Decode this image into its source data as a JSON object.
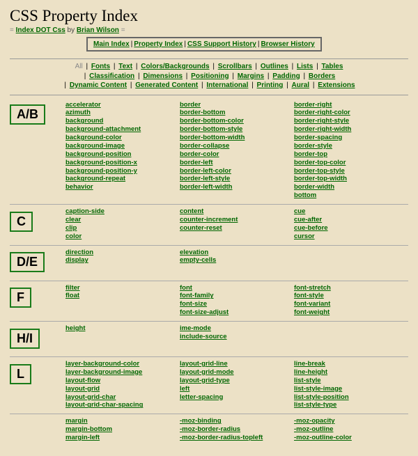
{
  "title": "CSS Property Index",
  "byline": {
    "prefix": "Index DOT Css",
    "by": "by",
    "author": "Brian Wilson"
  },
  "topnav": [
    "Main Index",
    "Property Index",
    "CSS Support History",
    "Browser History"
  ],
  "catnav_all": "All",
  "catnav": [
    "Fonts",
    "Text",
    "Colors/Backgrounds",
    "Scrollbars",
    "Outlines",
    "Lists",
    "Tables",
    "Classification",
    "Dimensions",
    "Positioning",
    "Margins",
    "Padding",
    "Borders",
    "Dynamic Content",
    "Generated Content",
    "International",
    "Printing",
    "Aural",
    "Extensions"
  ],
  "sections": [
    {
      "letter": "A/B",
      "cols": [
        [
          "accelerator",
          "azimuth",
          "background",
          "background-attachment",
          "background-color",
          "background-image",
          "background-position",
          "background-position-x",
          "background-position-y",
          "background-repeat",
          "behavior"
        ],
        [
          "border",
          "border-bottom",
          "border-bottom-color",
          "border-bottom-style",
          "border-bottom-width",
          "border-collapse",
          "border-color",
          "border-left",
          "border-left-color",
          "border-left-style",
          "border-left-width"
        ],
        [
          "border-right",
          "border-right-color",
          "border-right-style",
          "border-right-width",
          "border-spacing",
          "border-style",
          "border-top",
          "border-top-color",
          "border-top-style",
          "border-top-width",
          "border-width",
          "bottom"
        ]
      ]
    },
    {
      "letter": "C",
      "cols": [
        [
          "caption-side",
          "clear",
          "clip",
          "color"
        ],
        [
          "content",
          "counter-increment",
          "counter-reset"
        ],
        [
          "cue",
          "cue-after",
          "cue-before",
          "cursor"
        ]
      ]
    },
    {
      "letter": "D/E",
      "cols": [
        [
          "direction",
          "display"
        ],
        [
          "elevation",
          "empty-cells"
        ],
        []
      ]
    },
    {
      "letter": "F",
      "cols": [
        [
          "filter",
          "float"
        ],
        [
          "font",
          "font-family",
          "font-size",
          "font-size-adjust"
        ],
        [
          "font-stretch",
          "font-style",
          "font-variant",
          "font-weight"
        ]
      ]
    },
    {
      "letter": "H/I",
      "cols": [
        [
          "height"
        ],
        [
          "ime-mode",
          "include-source"
        ],
        []
      ]
    },
    {
      "letter": "L",
      "cols": [
        [
          "layer-background-color",
          "layer-background-image",
          "layout-flow",
          "layout-grid",
          "layout-grid-char",
          "layout-grid-char-spacing"
        ],
        [
          "layout-grid-line",
          "layout-grid-mode",
          "layout-grid-type",
          "left",
          "letter-spacing"
        ],
        [
          "line-break",
          "line-height",
          "list-style",
          "list-style-image",
          "list-style-position",
          "list-style-type"
        ]
      ]
    },
    {
      "letter": "",
      "cols": [
        [
          "margin",
          "margin-bottom",
          "margin-left"
        ],
        [
          "-moz-binding",
          "-moz-border-radius",
          "-moz-border-radius-topleft"
        ],
        [
          "-moz-opacity",
          "-moz-outline",
          "-moz-outline-color"
        ]
      ]
    }
  ]
}
